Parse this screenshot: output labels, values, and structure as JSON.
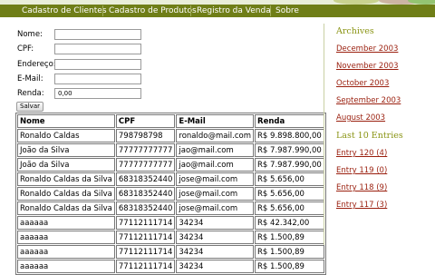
{
  "nav": {
    "items": [
      "Cadastro de Clientes",
      "Cadastro de Produtos",
      "Registro da Venda",
      "Sobre"
    ]
  },
  "form": {
    "nome_label": "Nome:",
    "cpf_label": "CPF:",
    "endereco_label": "Endereço:",
    "email_label": "E-Mail:",
    "renda_label": "Renda:",
    "nome_value": "",
    "cpf_value": "",
    "endereco_value": "",
    "email_value": "",
    "renda_value": "0,00",
    "save_label": "Salvar"
  },
  "table": {
    "headers": [
      "Nome",
      "CPF",
      "E-Mail",
      "Renda"
    ],
    "rows": [
      [
        "Ronaldo Caldas",
        "798798798",
        "ronaldo@mail.com",
        "R$ 9.898.800,00"
      ],
      [
        "João da Silva",
        "77777777777",
        "jao@mail.com",
        "R$ 7.987.990,00"
      ],
      [
        "João da Silva",
        "77777777777",
        "jao@mail.com",
        "R$ 7.987.990,00"
      ],
      [
        "Ronaldo Caldas da Silva",
        "68318352440",
        "jose@mail.com",
        "R$ 5.656,00"
      ],
      [
        "Ronaldo Caldas da Silva",
        "68318352440",
        "jose@mail.com",
        "R$ 5.656,00"
      ],
      [
        "Ronaldo Caldas da Silva",
        "68318352440",
        "jose@mail.com",
        "R$ 5.656,00"
      ],
      [
        "aaaaaa",
        "77112111714",
        "34234",
        "R$ 42.342,00"
      ],
      [
        "aaaaaa",
        "77112111714",
        "34234",
        "R$ 1.500,89"
      ],
      [
        "aaaaaa",
        "77112111714",
        "34234",
        "R$ 1.500,89"
      ],
      [
        "aaaaaa",
        "77112111714",
        "34234",
        "R$ 1.500,89"
      ]
    ]
  },
  "sidebar": {
    "archives_heading": "Archives",
    "archives": [
      "December 2003",
      "November 2003",
      "October 2003",
      "September 2003",
      "August 2003"
    ],
    "entries_heading": "Last 10 Entries",
    "entries": [
      "Entry 120 (4)",
      "Entry 119 (0)",
      "Entry 118 (9)",
      "Entry 117 (3)"
    ]
  },
  "colors": {
    "nav_bg": "#6f7e17",
    "heading": "#8a9414",
    "link": "#9a1f0e"
  }
}
